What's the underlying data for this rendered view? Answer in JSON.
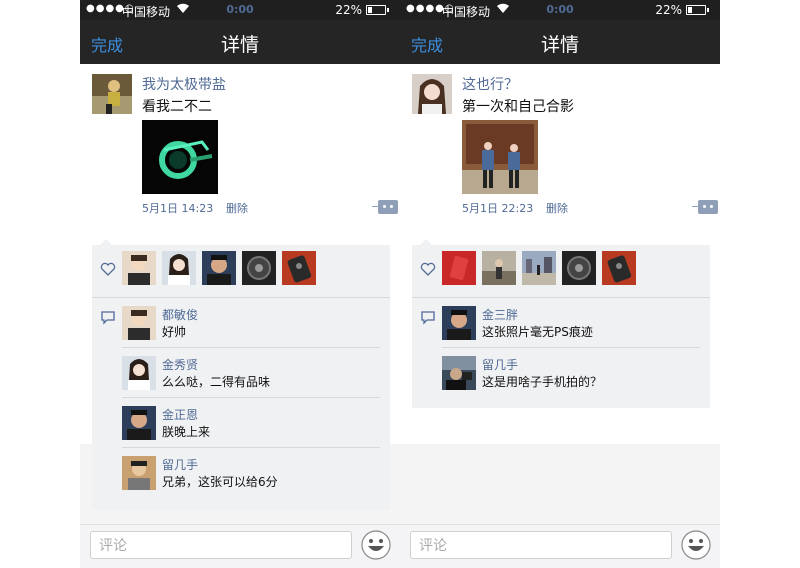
{
  "status_bar": {
    "carrier": "中国移动",
    "time": "0:00",
    "battery": "22%",
    "battery_level": 0.22
  },
  "nav": {
    "done_label": "完成",
    "title": "详情"
  },
  "input": {
    "placeholder": "评论"
  },
  "phones": [
    {
      "post": {
        "username": "我为太极带盐",
        "text": "看我二不二",
        "time": "5月1日 14:23",
        "delete_label": "删除"
      },
      "comments": [
        {
          "name": "都敏俊",
          "text": "好帅"
        },
        {
          "name": "金秀贤",
          "text": "么么哒，二得有品味"
        },
        {
          "name": "金正恩",
          "text": "朕晚上来"
        },
        {
          "name": "留几手",
          "text": "兄弟，这张可以给6分"
        }
      ]
    },
    {
      "post": {
        "username": "这也行？",
        "text": "第一次和自己合影",
        "time": "5月1日 22:23",
        "delete_label": "删除"
      },
      "comments": [
        {
          "name": "金三胖",
          "text": "这张照片毫无PS痕迹"
        },
        {
          "name": "留几手",
          "text": "这是用啥子手机拍的？"
        }
      ]
    }
  ],
  "colors": {
    "link": "#4f6a95",
    "nav_bg": "#252525",
    "done": "#3b8fe0",
    "panel": "#f0f1f3"
  }
}
